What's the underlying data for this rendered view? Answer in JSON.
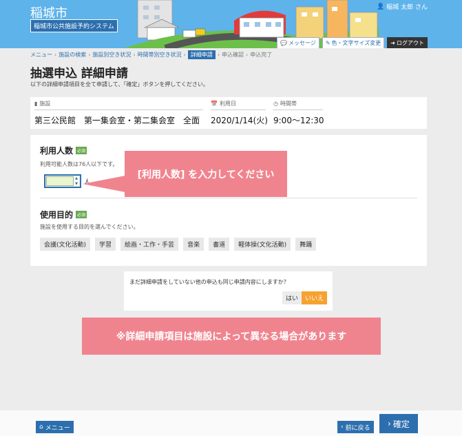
{
  "header": {
    "brand": "稲城市",
    "system_name": "稲城市公共施設予約システム",
    "user": "稲城 太郎 さん",
    "buttons": {
      "message": "メッセージ",
      "color": "色・文字サイズ変更",
      "logout": "ログアウト"
    }
  },
  "breadcrumb": [
    {
      "label": "メニュー",
      "state": "link"
    },
    {
      "label": "施設の検索",
      "state": "link"
    },
    {
      "label": "施設別空き状況",
      "state": "link"
    },
    {
      "label": "時間帯別空き状況",
      "state": "link"
    },
    {
      "label": "詳細申請",
      "state": "active"
    },
    {
      "label": "申込確認",
      "state": "todo"
    },
    {
      "label": "申込完了",
      "state": "todo"
    }
  ],
  "page": {
    "title": "抽選申込 詳細申請",
    "description": "以下の詳細申請項目を全て申請して、「確定」ボタンを押してください。"
  },
  "facility": {
    "facility_label": "施設",
    "facility_value": "第三公民館　第一集会室・第二集会室　全面",
    "date_label": "利用日",
    "date_value": "2020/1/14(火)",
    "time_label": "時間帯",
    "time_value": "9:00～12:30"
  },
  "form": {
    "count_title": "利用人数",
    "required": "必須",
    "count_hint": "利用可能人数は76人以下です。",
    "count_value": "",
    "count_unit": "人",
    "purpose_title": "使用目的",
    "purpose_hint": "施設を使用する目的を選んでください。",
    "purposes": [
      "会議(文化活動)",
      "学習",
      "絵画・工作・手芸",
      "音楽",
      "書道",
      "軽体操(文化活動)",
      "舞踊"
    ]
  },
  "callouts": {
    "count": "[利用人数] を入力してください",
    "note": "※詳細申請項目は施設によって異なる場合があります"
  },
  "question": {
    "text": "まだ詳細申請をしていない他の申込も同じ申請内容にしますか？",
    "yes": "はい",
    "no": "いいえ"
  },
  "footer": {
    "menu": "メニュー",
    "back": "前に戻る",
    "confirm": "確定"
  },
  "colors": {
    "primary": "#2d6fae",
    "accent": "#f6a230",
    "callout": "#f0848e",
    "required": "#6aa84f",
    "header_sky": "#5eb3ea"
  }
}
